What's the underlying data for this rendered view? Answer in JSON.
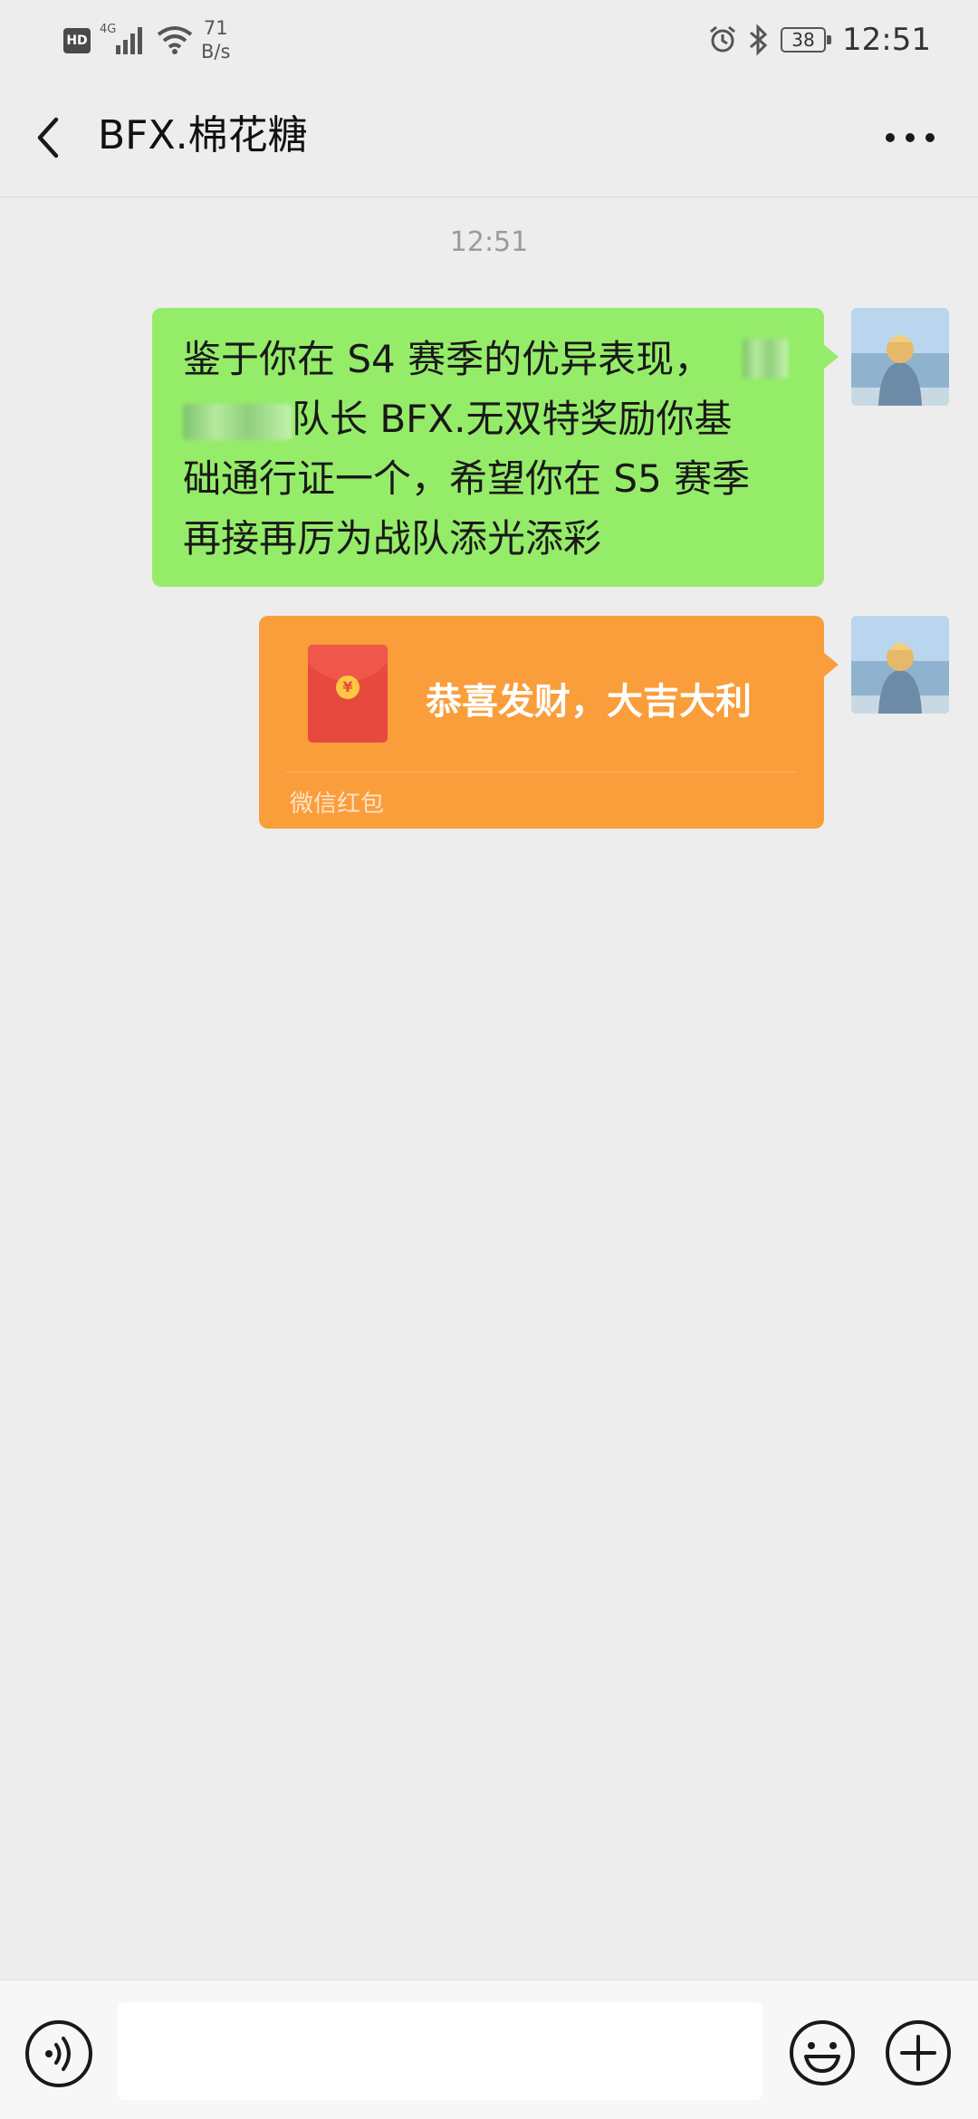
{
  "status_bar": {
    "hd_label": "HD",
    "network_label": "4G",
    "speed_value": "71",
    "speed_unit": "B/s",
    "battery": "38",
    "time": "12:51"
  },
  "header": {
    "title": "BFX.棉花糖"
  },
  "chat": {
    "timestamp": "12:51",
    "messages": [
      {
        "type": "text",
        "line1": "鉴于你在 S4 赛季的优异表现，",
        "line2_visible": "队长 BFX.无双特奖励你基",
        "line3": "础通行证一个，希望你在 S5 赛季",
        "line4": "再接再厉为战队添光添彩"
      },
      {
        "type": "red_packet",
        "greeting": "恭喜发财，大吉大利",
        "label": "微信红包",
        "coin_symbol": "¥"
      }
    ]
  },
  "colors": {
    "background": "#ededed",
    "text_bubble": "#95ec69",
    "red_packet": "#fa9d3b",
    "packet_icon": "#e8493f"
  },
  "icons": {
    "back": "chevron-left-icon",
    "more": "more-dots-icon",
    "voice": "voice-icon",
    "emoji": "emoji-icon",
    "plus": "plus-icon"
  }
}
